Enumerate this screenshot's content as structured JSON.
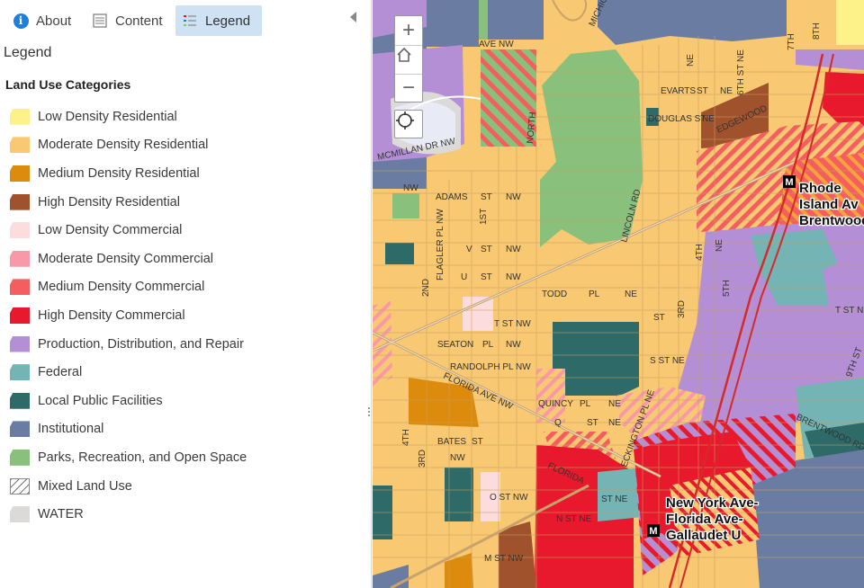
{
  "tabs": {
    "about": "About",
    "content": "Content",
    "legend": "Legend"
  },
  "panel": {
    "title": "Legend",
    "layer_title": "Land Use Categories"
  },
  "legend_items": [
    {
      "label": "Low Density Residential",
      "color": "#fdf28a"
    },
    {
      "label": "Moderate Density Residential",
      "color": "#f8c872"
    },
    {
      "label": "Medium Density Residential",
      "color": "#dd8b0d"
    },
    {
      "label": "High Density Residential",
      "color": "#a0522d"
    },
    {
      "label": "Low Density Commercial",
      "color": "#fcdcdc"
    },
    {
      "label": "Moderate Density Commercial",
      "color": "#f998a8"
    },
    {
      "label": "Medium Density Commercial",
      "color": "#f45e5e"
    },
    {
      "label": "High Density Commercial",
      "color": "#e8192c"
    },
    {
      "label": "Production, Distribution, and Repair",
      "color": "#b58fd6"
    },
    {
      "label": "Federal",
      "color": "#74b4b4"
    },
    {
      "label": "Local Public Facilities",
      "color": "#2e6a68"
    },
    {
      "label": "Institutional",
      "color": "#6b7ca3"
    },
    {
      "label": "Parks, Recreation, and Open Space",
      "color": "#88c07c"
    },
    {
      "label": "Mixed Land Use",
      "color": "hatch"
    },
    {
      "label": "WATER",
      "color": "#dcdad8"
    }
  ],
  "map": {
    "controls": {
      "zoom_in": "+",
      "zoom_out": "−"
    },
    "stations": [
      {
        "line1": "Rhode",
        "line2": "Island Av",
        "line3": "Brentwood"
      },
      {
        "line1": "New York Ave-",
        "line2": "Florida Ave-",
        "line3": "Gallaudet U"
      }
    ],
    "metro_glyph": "M",
    "street_labels": [
      "AVE NW",
      "MCMILLAN DR NW",
      "NW",
      "ADAMS",
      "ST",
      "NW",
      "FLAGLER PL NW",
      "1ST",
      "V",
      "ST",
      "NW",
      "U",
      "ST",
      "NW",
      "2ND",
      "LINCOLN RD",
      "NORTH",
      "EVARTS",
      "ST",
      "NE",
      "DOUGLAS ST",
      "NE",
      "EDGEWOOD",
      "TODD",
      "PL",
      "NE",
      "T ST NW",
      "SEATON",
      "PL",
      "NW",
      "RANDOLPH PL NW",
      "QUINCY",
      "PL",
      "NE",
      "Q",
      "ST",
      "NE",
      "FLORIDA AVE NW",
      "BATES",
      "ST",
      "NW",
      "S ST NE",
      "ECKINGTON PL NE",
      "O ST NW",
      "N ST NE",
      "M ST NW",
      "ST NE",
      "FLORIDA",
      "4TH",
      "3RD",
      "BRENTWOOD RD",
      "5TH",
      "T ST NE",
      "9TH ST",
      "4TH",
      "3RD",
      "6TH ST NE",
      "7TH",
      "8TH",
      "MICHIGAN",
      "NE",
      "ST",
      "NE"
    ]
  }
}
